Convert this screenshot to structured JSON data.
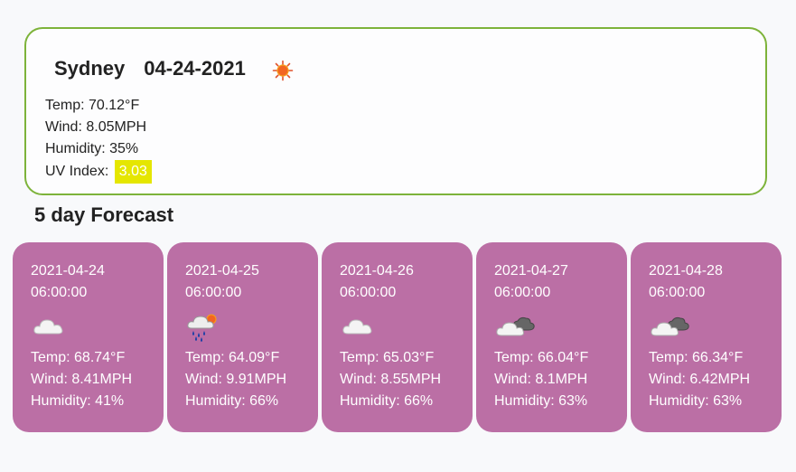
{
  "current": {
    "city": "Sydney",
    "date": "04-24-2021",
    "icon": "sun-icon",
    "temp": "Temp: 70.12°F",
    "wind": "Wind: 8.05MPH",
    "humidity": "Humidity: 35%",
    "uv_label": "UV Index:",
    "uv_value": "3.03",
    "uv_color": "#e5e600"
  },
  "forecast_heading": "5 day Forecast",
  "forecast": [
    {
      "date": "2021-04-24",
      "time": "06:00:00",
      "icon": "cloud-icon",
      "temp": "Temp: 68.74°F",
      "wind": "Wind: 8.41MPH",
      "humidity": "Humidity: 41%"
    },
    {
      "date": "2021-04-25",
      "time": "06:00:00",
      "icon": "rain-sun-icon",
      "temp": "Temp: 64.09°F",
      "wind": "Wind: 9.91MPH",
      "humidity": "Humidity: 66%"
    },
    {
      "date": "2021-04-26",
      "time": "06:00:00",
      "icon": "cloud-icon",
      "temp": "Temp: 65.03°F",
      "wind": "Wind: 8.55MPH",
      "humidity": "Humidity: 66%"
    },
    {
      "date": "2021-04-27",
      "time": "06:00:00",
      "icon": "broken-clouds-icon",
      "temp": "Temp: 66.04°F",
      "wind": "Wind: 8.1MPH",
      "humidity": "Humidity: 63%"
    },
    {
      "date": "2021-04-28",
      "time": "06:00:00",
      "icon": "broken-clouds-icon",
      "temp": "Temp: 66.34°F",
      "wind": "Wind: 6.42MPH",
      "humidity": "Humidity: 63%"
    }
  ],
  "colors": {
    "card_bg": "#bb6fa5",
    "current_border": "#7db33a"
  }
}
